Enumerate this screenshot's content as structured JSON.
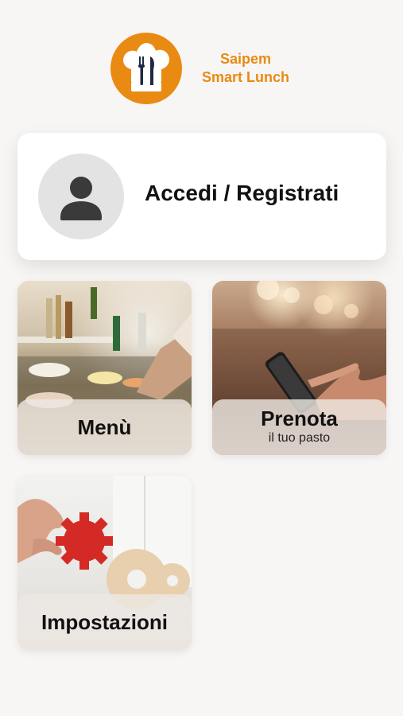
{
  "brand": {
    "line1": "Saipem",
    "line2": "Smart Lunch",
    "color": "#e98a12",
    "icon": "chef-hat-fork-knife-icon"
  },
  "login": {
    "label": "Accedi / Registrati",
    "icon": "user-avatar-icon"
  },
  "tiles": [
    {
      "title": "Menù",
      "subtitle": ""
    },
    {
      "title": "Prenota",
      "subtitle": "il tuo pasto"
    },
    {
      "title": "Impostazioni",
      "subtitle": ""
    }
  ]
}
